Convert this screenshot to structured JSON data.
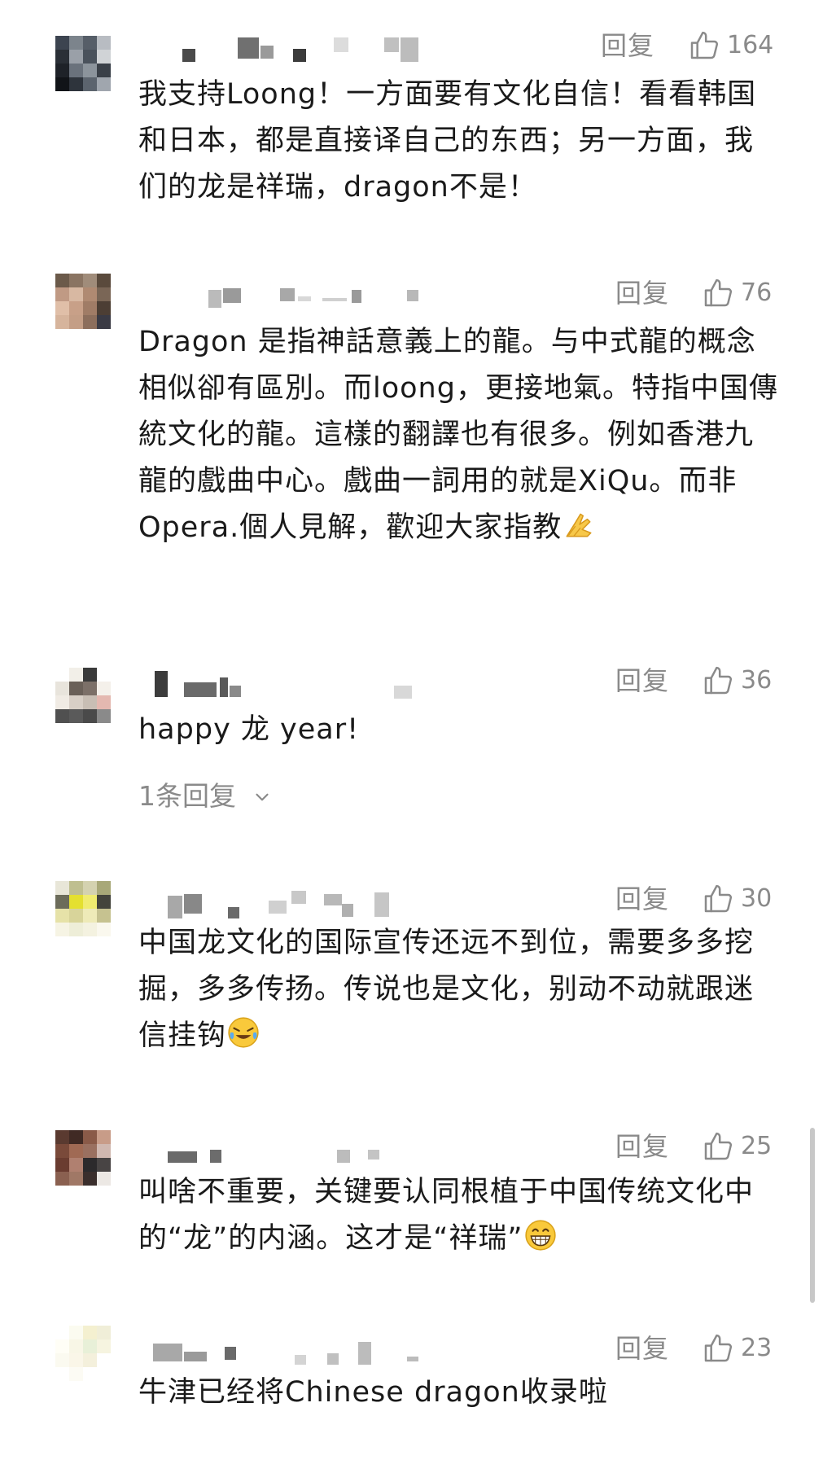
{
  "comments": [
    {
      "avatar_colors": [
        "#3c4450",
        "#7c848c",
        "#565e68",
        "#b8bcc2",
        "#2a2f36",
        "#9aa0a8",
        "#4a525c",
        "#d0d3d6",
        "#1e2228",
        "#6a727c",
        "#8c949c",
        "#3a4048",
        "#111418",
        "#2e343c",
        "#5c646e",
        "#a0a6ae"
      ],
      "reply_label": "回复",
      "likes": "164",
      "text": "我支持Loong！一方面要有文化自信！看看韩国和日本，都是直接译自己的东西；另一方面，我们的龙是祥瑞，dragon不是！"
    },
    {
      "avatar_colors": [
        "#6b5a4a",
        "#8a7462",
        "#a08c7a",
        "#5a4a3c",
        "#c09a84",
        "#d8b8a2",
        "#b08a72",
        "#7a6656",
        "#e0bfa8",
        "#c8a088",
        "#a07c66",
        "#4c3e34",
        "#d6b49c",
        "#c49e86",
        "#8c6e5c",
        "#3a3a44"
      ],
      "reply_label": "回复",
      "likes": "76",
      "text": "Dragon 是指神話意義上的龍。与中式龍的概念相似卻有區別。而loong，更接地氣。特指中国傳統文化的龍。這樣的翻譯也有很多。例如香港九龍的戲曲中心。戲曲一詞用的就是XiQu。而非Opera.個人見解，歡迎大家指教"
    },
    {
      "avatar_colors": [
        "#ffffff",
        "#f2efe8",
        "#3a3a3a",
        "#ffffff",
        "#e8e4dc",
        "#6a6058",
        "#7c7068",
        "#f4f0ea",
        "#f0ebe4",
        "#d8cfc6",
        "#c8beb4",
        "#e4b8b0",
        "#505050",
        "#5a5a5a",
        "#4a4a4a",
        "#8a8a8a"
      ],
      "reply_label": "回复",
      "likes": "36",
      "text": "happy 龙 year!",
      "sub_replies": "1条回复"
    },
    {
      "avatar_colors": [
        "#e8e6d8",
        "#bfbf90",
        "#d4d2b0",
        "#a8a878",
        "#6c6c5a",
        "#e4e030",
        "#f0ec70",
        "#44443c",
        "#e6e2a8",
        "#d8d49a",
        "#eeeab8",
        "#c6c290",
        "#f6f4e4",
        "#eeeed8",
        "#f4f2e0",
        "#faf8ee"
      ],
      "reply_label": "回复",
      "likes": "30",
      "text": "中国龙文化的国际宣传还远不到位，需要多多挖掘，多多传扬。传说也是文化，别动不动就跟迷信挂钩"
    },
    {
      "avatar_colors": [
        "#5a3a30",
        "#402a24",
        "#8a5a48",
        "#c89c88",
        "#7a4a3a",
        "#a06a54",
        "#9a7060",
        "#d0b8b0",
        "#6a3c30",
        "#b08070",
        "#2c2a2c",
        "#484444",
        "#8a6050",
        "#a07866",
        "#3a2e2c",
        "#ece8e4"
      ],
      "reply_label": "回复",
      "likes": "25",
      "text": "叫啥不重要，关键要认同根植于中国传统文化中的“龙”的内涵。这才是“祥瑞”"
    },
    {
      "avatar_colors": [
        "#ffffff",
        "#fbfbf0",
        "#f4f0d0",
        "#f0eed8",
        "#fffef6",
        "#f8f6e6",
        "#e8f0d8",
        "#f6f4e0",
        "#fbfaf0",
        "#faf6e8",
        "#f4f0dc",
        "#ffffff",
        "#ffffff",
        "#fcfbf4",
        "#ffffff",
        "#ffffff"
      ],
      "reply_label": "回复",
      "likes": "23",
      "text": "牛津已经将Chinese dragon收录啦"
    }
  ]
}
